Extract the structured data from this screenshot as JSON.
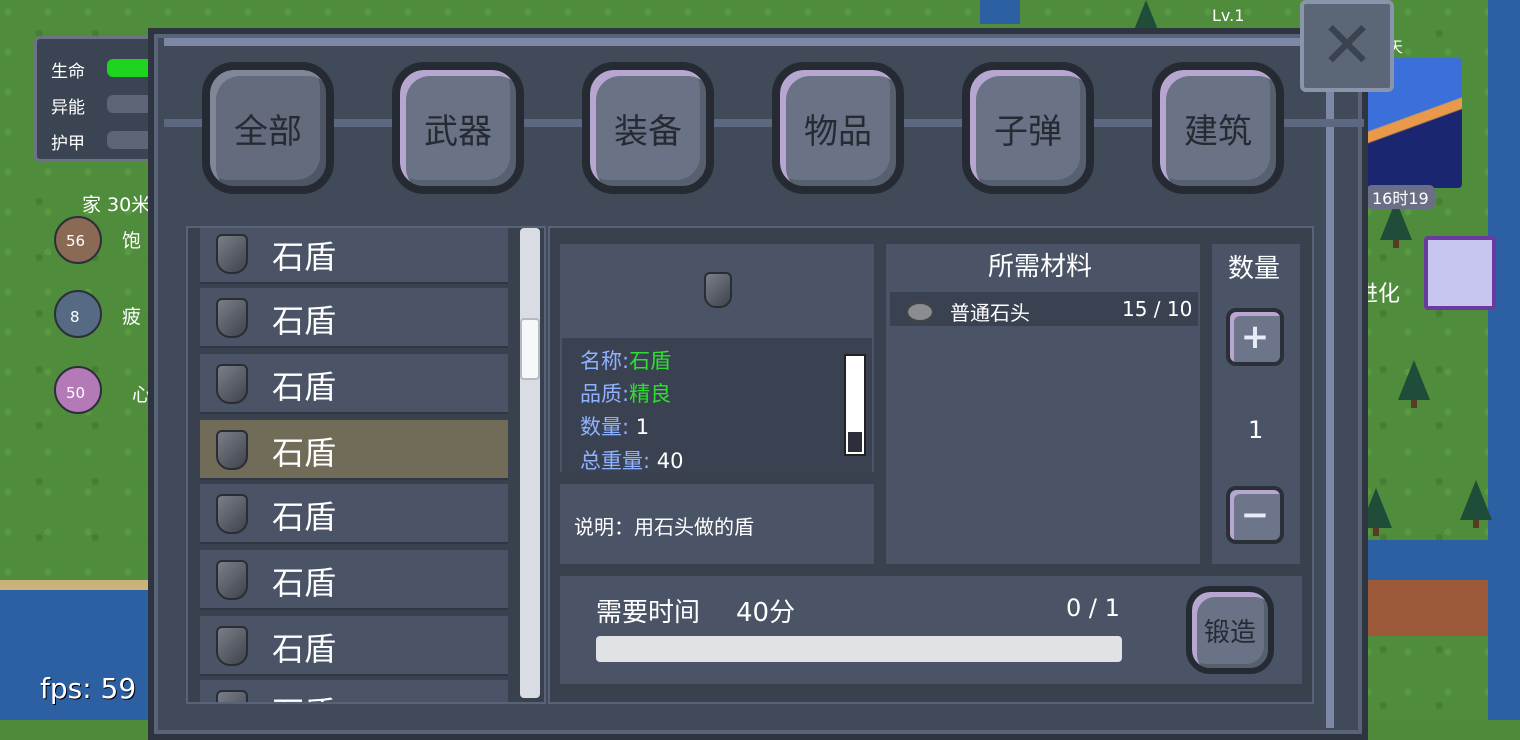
{
  "hud": {
    "stats": [
      {
        "label": "生命"
      },
      {
        "label": "异能"
      },
      {
        "label": "护甲"
      }
    ],
    "home_text": "家 30米",
    "indicators": [
      {
        "value": "56",
        "label": "饱"
      },
      {
        "value": "8",
        "label": "疲"
      },
      {
        "value": "50",
        "label": "心"
      }
    ],
    "fps": "fps: 59",
    "level": "Lv.1",
    "day": "天",
    "time": "16时19",
    "evolve": "进化"
  },
  "tabs": [
    {
      "label": "全部",
      "active": true
    },
    {
      "label": "武器",
      "active": false
    },
    {
      "label": "装备",
      "active": false
    },
    {
      "label": "物品",
      "active": false
    },
    {
      "label": "子弹",
      "active": false
    },
    {
      "label": "建筑",
      "active": false
    }
  ],
  "items": [
    {
      "name": "石盾"
    },
    {
      "name": "石盾"
    },
    {
      "name": "石盾"
    },
    {
      "name": "石盾",
      "selected": true
    },
    {
      "name": "石盾"
    },
    {
      "name": "石盾"
    },
    {
      "name": "石盾"
    },
    {
      "name": "石盾"
    }
  ],
  "detail": {
    "name_label": "名称:",
    "name_value": "石盾",
    "quality_label": "品质:",
    "quality_value": "精良",
    "count_label": "数量:",
    "count_value": "1",
    "weight_label": "总重量:",
    "weight_value": "40",
    "description": "说明：用石头做的盾"
  },
  "materials": {
    "title": "所需材料",
    "rows": [
      {
        "name": "普通石头",
        "count": "15 / 10"
      }
    ]
  },
  "quantity": {
    "title": "数量",
    "value": "1",
    "plus": "+",
    "minus": "−"
  },
  "forge": {
    "time_label": "需要时间",
    "time_value": "40分",
    "progress_text": "0 / 1",
    "progress": 0,
    "button_label": "锻造"
  },
  "close": "✕"
}
